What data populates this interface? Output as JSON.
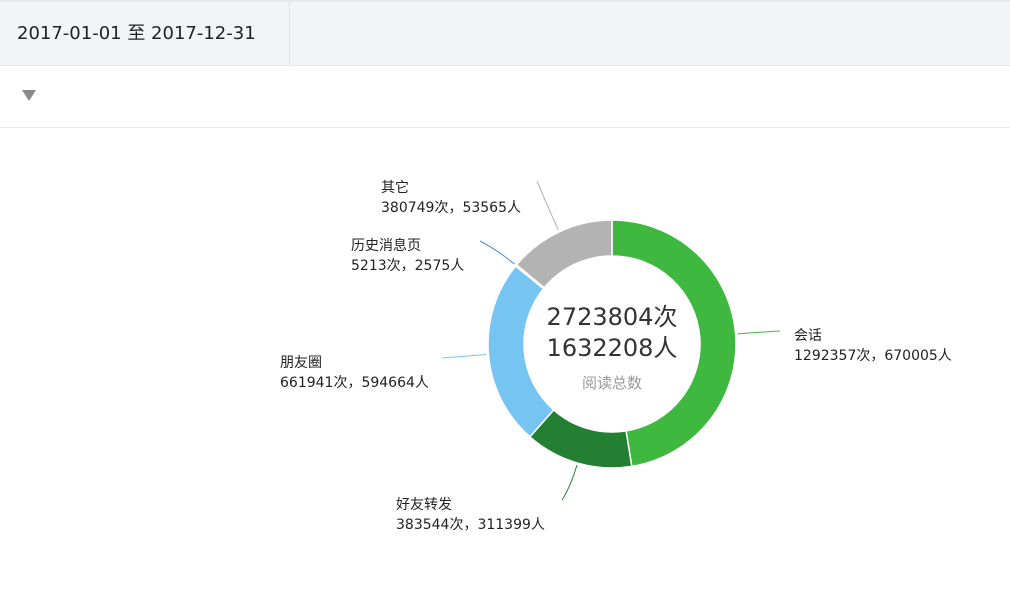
{
  "header": {
    "date_range": "2017-01-01 至 2017-12-31"
  },
  "chart_data": {
    "type": "pie",
    "donut": true,
    "center": {
      "reads": "2723804次",
      "users": "1632208人",
      "label": "阅读总数"
    },
    "slices": [
      {
        "name": "会话",
        "value": 1292357,
        "users": 670005,
        "color": "#3fb83f",
        "text_name": "会话",
        "text_value": "1292357次，670005人"
      },
      {
        "name": "好友转发",
        "value": 383544,
        "users": 311399,
        "color": "#237f32",
        "text_name": "好友转发",
        "text_value": "383544次，311399人"
      },
      {
        "name": "朋友圈",
        "value": 661941,
        "users": 594664,
        "color": "#75c4f2",
        "text_name": "朋友圈",
        "text_value": "661941次，594664人"
      },
      {
        "name": "历史消息页",
        "value": 5213,
        "users": 2575,
        "color": "#4a90d9",
        "text_name": "历史消息页",
        "text_value": "5213次，2575人"
      },
      {
        "name": "其它",
        "value": 380749,
        "users": 53565,
        "color": "#b3b3b3",
        "text_name": "其它",
        "text_value": "380749次，53565人"
      }
    ]
  }
}
